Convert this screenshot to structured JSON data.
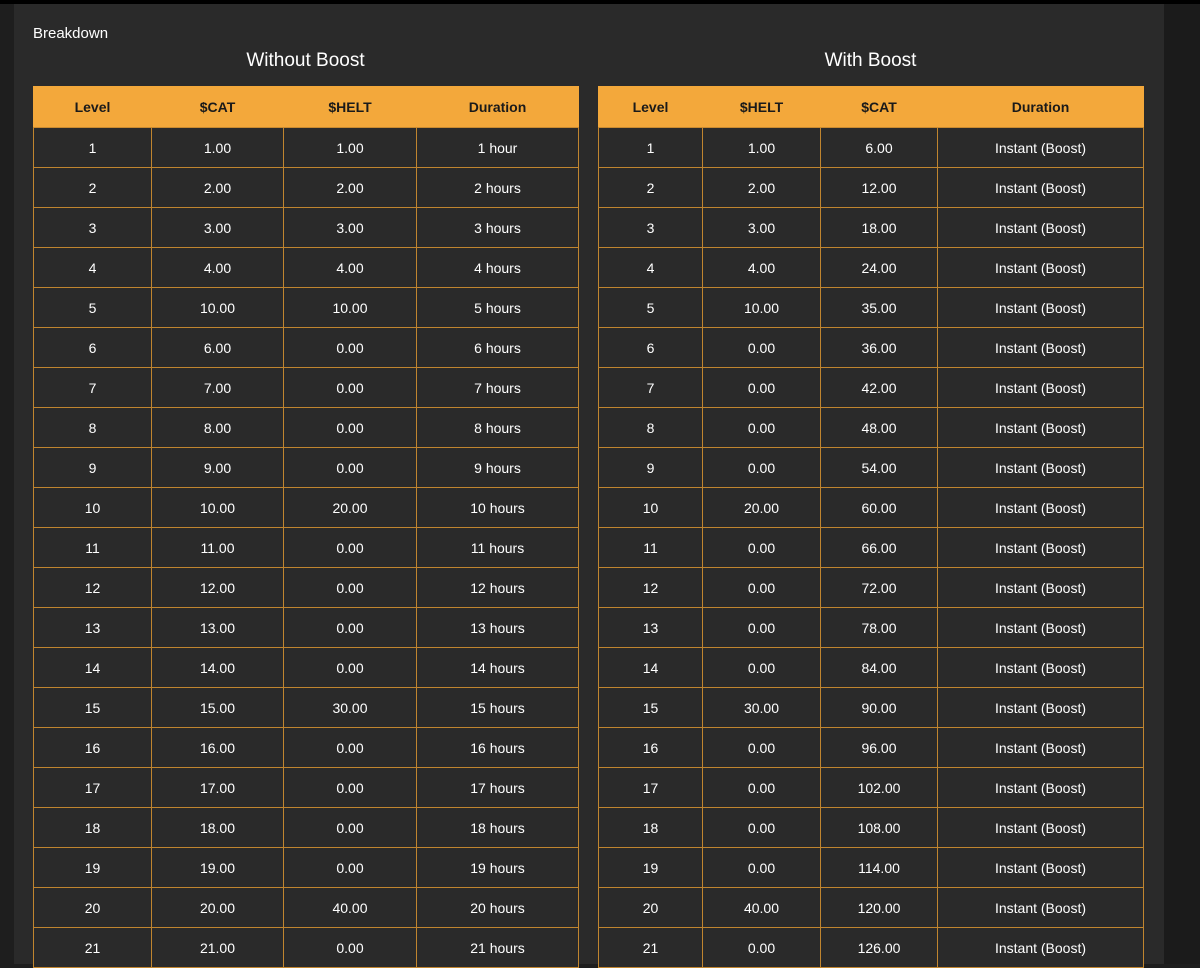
{
  "page": {
    "heading": "Breakdown",
    "accent_color": "#f3a83b",
    "background_color": "#2a2a2a"
  },
  "without_boost": {
    "title": "Without Boost",
    "headers": [
      "Level",
      "$CAT",
      "$HELT",
      "Duration"
    ],
    "rows": [
      [
        "1",
        "1.00",
        "1.00",
        "1 hour"
      ],
      [
        "2",
        "2.00",
        "2.00",
        "2 hours"
      ],
      [
        "3",
        "3.00",
        "3.00",
        "3 hours"
      ],
      [
        "4",
        "4.00",
        "4.00",
        "4 hours"
      ],
      [
        "5",
        "10.00",
        "10.00",
        "5 hours"
      ],
      [
        "6",
        "6.00",
        "0.00",
        "6 hours"
      ],
      [
        "7",
        "7.00",
        "0.00",
        "7 hours"
      ],
      [
        "8",
        "8.00",
        "0.00",
        "8 hours"
      ],
      [
        "9",
        "9.00",
        "0.00",
        "9 hours"
      ],
      [
        "10",
        "10.00",
        "20.00",
        "10 hours"
      ],
      [
        "11",
        "11.00",
        "0.00",
        "11 hours"
      ],
      [
        "12",
        "12.00",
        "0.00",
        "12 hours"
      ],
      [
        "13",
        "13.00",
        "0.00",
        "13 hours"
      ],
      [
        "14",
        "14.00",
        "0.00",
        "14 hours"
      ],
      [
        "15",
        "15.00",
        "30.00",
        "15 hours"
      ],
      [
        "16",
        "16.00",
        "0.00",
        "16 hours"
      ],
      [
        "17",
        "17.00",
        "0.00",
        "17 hours"
      ],
      [
        "18",
        "18.00",
        "0.00",
        "18 hours"
      ],
      [
        "19",
        "19.00",
        "0.00",
        "19 hours"
      ],
      [
        "20",
        "20.00",
        "40.00",
        "20 hours"
      ],
      [
        "21",
        "21.00",
        "0.00",
        "21 hours"
      ]
    ]
  },
  "with_boost": {
    "title": "With Boost",
    "headers": [
      "Level",
      "$HELT",
      "$CAT",
      "Duration"
    ],
    "rows": [
      [
        "1",
        "1.00",
        "6.00",
        "Instant (Boost)"
      ],
      [
        "2",
        "2.00",
        "12.00",
        "Instant (Boost)"
      ],
      [
        "3",
        "3.00",
        "18.00",
        "Instant (Boost)"
      ],
      [
        "4",
        "4.00",
        "24.00",
        "Instant (Boost)"
      ],
      [
        "5",
        "10.00",
        "35.00",
        "Instant (Boost)"
      ],
      [
        "6",
        "0.00",
        "36.00",
        "Instant (Boost)"
      ],
      [
        "7",
        "0.00",
        "42.00",
        "Instant (Boost)"
      ],
      [
        "8",
        "0.00",
        "48.00",
        "Instant (Boost)"
      ],
      [
        "9",
        "0.00",
        "54.00",
        "Instant (Boost)"
      ],
      [
        "10",
        "20.00",
        "60.00",
        "Instant (Boost)"
      ],
      [
        "11",
        "0.00",
        "66.00",
        "Instant (Boost)"
      ],
      [
        "12",
        "0.00",
        "72.00",
        "Instant (Boost)"
      ],
      [
        "13",
        "0.00",
        "78.00",
        "Instant (Boost)"
      ],
      [
        "14",
        "0.00",
        "84.00",
        "Instant (Boost)"
      ],
      [
        "15",
        "30.00",
        "90.00",
        "Instant (Boost)"
      ],
      [
        "16",
        "0.00",
        "96.00",
        "Instant (Boost)"
      ],
      [
        "17",
        "0.00",
        "102.00",
        "Instant (Boost)"
      ],
      [
        "18",
        "0.00",
        "108.00",
        "Instant (Boost)"
      ],
      [
        "19",
        "0.00",
        "114.00",
        "Instant (Boost)"
      ],
      [
        "20",
        "40.00",
        "120.00",
        "Instant (Boost)"
      ],
      [
        "21",
        "0.00",
        "126.00",
        "Instant (Boost)"
      ]
    ]
  }
}
